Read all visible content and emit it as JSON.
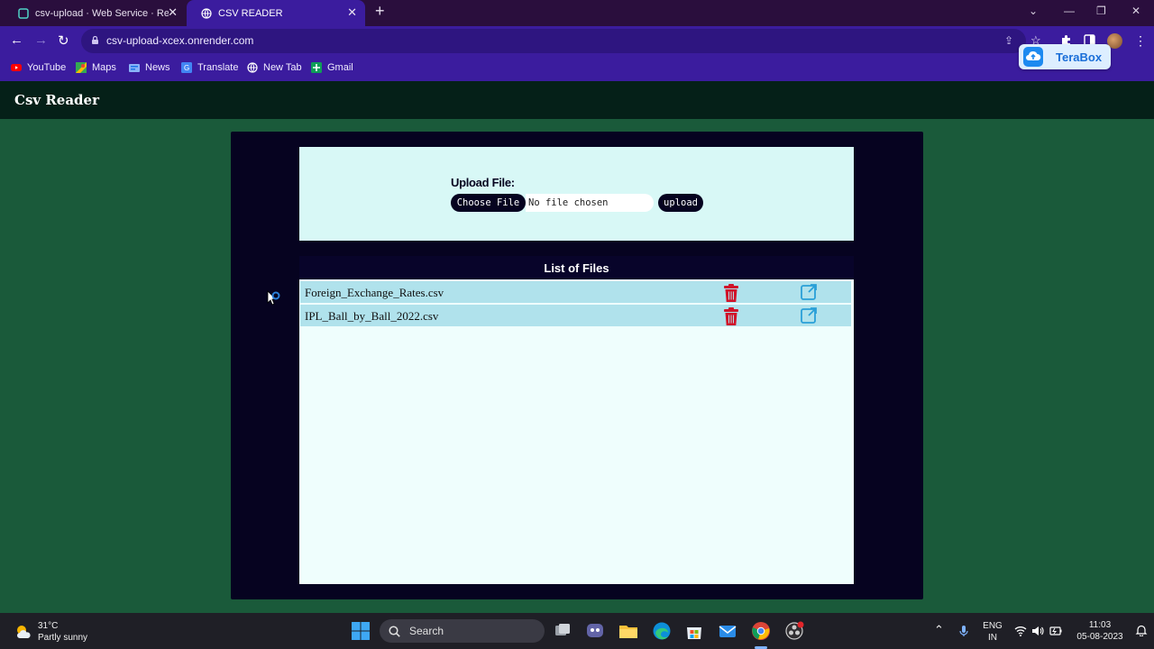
{
  "browser": {
    "tabs": [
      {
        "title": "csv-upload · Web Service · Render",
        "active": false
      },
      {
        "title": "CSV READER",
        "active": true
      }
    ],
    "url": "csv-upload-xcex.onrender.com",
    "bookmarks": [
      {
        "label": "YouTube",
        "icon": "youtube-icon"
      },
      {
        "label": "Maps",
        "icon": "maps-icon"
      },
      {
        "label": "News",
        "icon": "news-icon"
      },
      {
        "label": "Translate",
        "icon": "translate-icon"
      },
      {
        "label": "New Tab",
        "icon": "globe-icon"
      },
      {
        "label": "Gmail",
        "icon": "gmail-icon"
      }
    ],
    "extension_popup": "TeraBox"
  },
  "app": {
    "brand": "Csv Reader",
    "upload": {
      "label": "Upload File:",
      "choose_button": "Choose File",
      "file_status": "No file chosen",
      "upload_button": "upload"
    },
    "files": {
      "heading": "List of Files",
      "items": [
        {
          "name": "Foreign_Exchange_Rates.csv"
        },
        {
          "name": "IPL_Ball_by_Ball_2022.csv"
        }
      ]
    },
    "colors": {
      "accent_dark": "#060320",
      "page_bg": "#1a5a3a",
      "trash": "#d0142a",
      "open_link": "#2aa0d8"
    }
  },
  "taskbar": {
    "weather_temp": "31°C",
    "weather_desc": "Partly sunny",
    "search_placeholder": "Search",
    "lang_line1": "ENG",
    "lang_line2": "IN",
    "time": "11:03",
    "date": "05-08-2023"
  }
}
